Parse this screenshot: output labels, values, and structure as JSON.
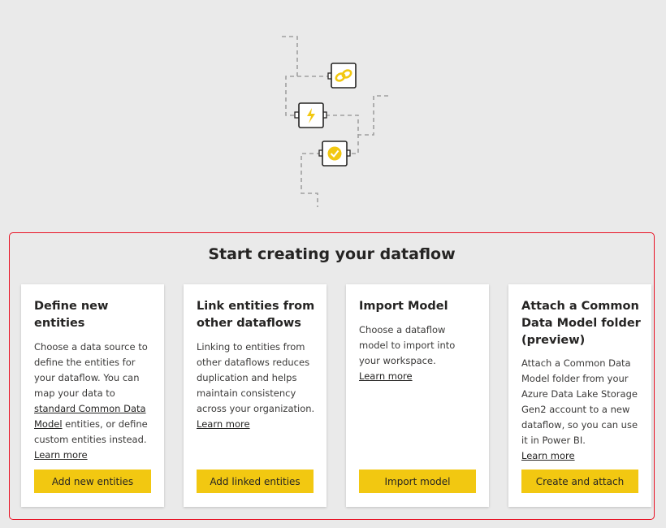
{
  "section": {
    "title": "Start creating your dataflow"
  },
  "cards": [
    {
      "title": "Define new entities",
      "body_before": "Choose a data source to define the entities for your dataflow. You can map your data to ",
      "body_link": "standard Common Data Model",
      "body_after": " entities, or define custom entities instead.",
      "learn_more": "Learn more",
      "button": "Add new entities"
    },
    {
      "title": "Link entities from other dataflows",
      "body": "Linking to entities from other dataflows reduces duplication and helps maintain consistency across your organization.",
      "learn_more": "Learn more",
      "button": "Add linked entities"
    },
    {
      "title": "Import Model",
      "body": "Choose a dataflow model to import into your workspace.",
      "learn_more": "Learn more",
      "button": "Import model"
    },
    {
      "title": "Attach a Common Data Model folder (preview)",
      "body": "Attach a Common Data Model folder from your Azure Data Lake Storage Gen2 account to a new dataflow, so you can use it in Power BI.",
      "learn_more": "Learn more",
      "button": "Create and attach"
    }
  ],
  "illustration": {
    "icons": [
      "link-icon",
      "lightning-icon",
      "checkmark-badge-icon"
    ],
    "accent_color": "#f2c811",
    "connector_color": "#a0a0a0"
  }
}
